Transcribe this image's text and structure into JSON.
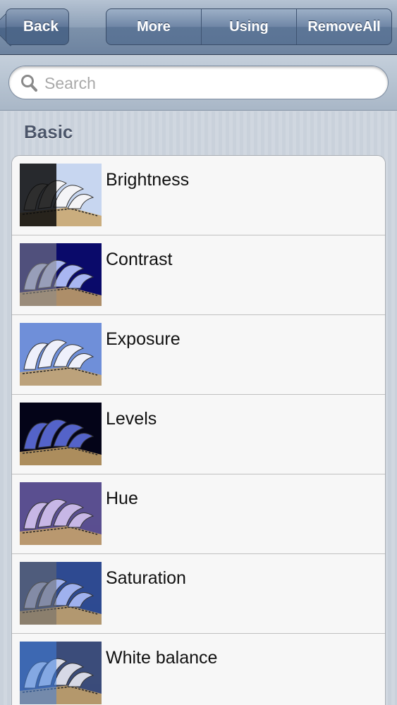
{
  "navbar": {
    "back_label": "Back",
    "segments": [
      "More",
      "Using",
      "RemoveAll"
    ]
  },
  "search": {
    "placeholder": "Search",
    "value": ""
  },
  "section": {
    "title": "Basic",
    "items": [
      {
        "label": "Brightness",
        "sky": "#c7d6f0",
        "left_tint": "#0a0a0a",
        "shell": "#f4f4f7",
        "split": "brightness"
      },
      {
        "label": "Contrast",
        "sky": "#0a0a6a",
        "left_tint": "#8a8a8a",
        "shell": "#a9b6f2",
        "split": "contrast"
      },
      {
        "label": "Exposure",
        "sky": "#6f8fd9",
        "left_tint": "",
        "shell": "#eef0fb",
        "split": "none"
      },
      {
        "label": "Levels",
        "sky": "#040418",
        "left_tint": "",
        "shell": "#5463c9",
        "split": "none"
      },
      {
        "label": "Hue",
        "sky": "#5a4f90",
        "left_tint": "",
        "shell": "#c7b7e6",
        "split": "none"
      },
      {
        "label": "Saturation",
        "sky": "#2e4a91",
        "left_tint": "#6b6b6b",
        "shell": "#9fb1ee",
        "split": "saturation"
      },
      {
        "label": "White balance",
        "sky": "#3b4c7a",
        "left_tint": "#3f7fe0",
        "shell": "#d7d9e6",
        "split": "whitebalance"
      }
    ]
  },
  "colors": {
    "nav_tint": "#6d83a0",
    "button_blue": "#4d6789",
    "section_text": "#4c566a"
  },
  "icons": {
    "search": "search-icon",
    "back": "chevron-left-icon"
  }
}
